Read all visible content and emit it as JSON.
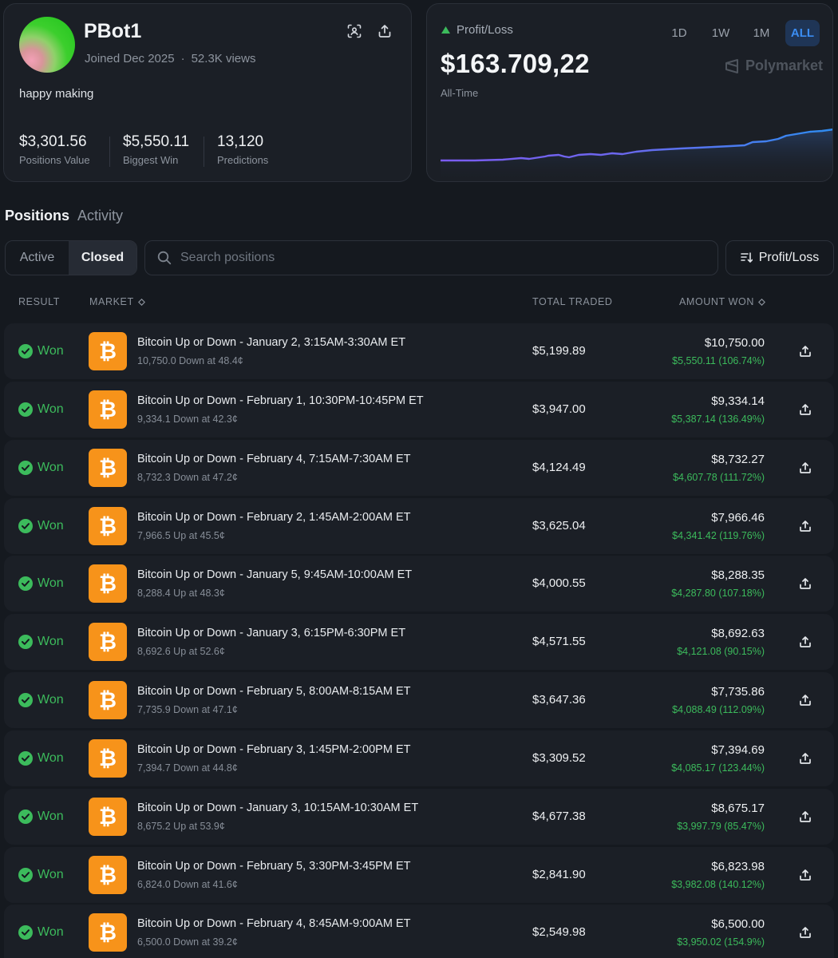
{
  "profile": {
    "username": "PBot1",
    "joined": "Joined Dec 2025",
    "views": "52.3K views",
    "bio": "happy making",
    "stats": [
      {
        "value": "$3,301.56",
        "label": "Positions Value"
      },
      {
        "value": "$5,550.11",
        "label": "Biggest Win"
      },
      {
        "value": "13,120",
        "label": "Predictions"
      }
    ],
    "icons": [
      "scan-icon",
      "share-icon"
    ]
  },
  "pnl": {
    "label": "Profit/Loss",
    "amount": "$163.709,22",
    "period": "All-Time",
    "ranges": [
      "1D",
      "1W",
      "1M",
      "ALL"
    ],
    "active_range": "ALL",
    "brand": "Polymarket",
    "colors": {
      "line_start": "#7b5cf0",
      "line_end": "#2e8cf0",
      "accent": "#3b8df2",
      "positive": "#3cbb5c"
    }
  },
  "tabs": {
    "positions": "Positions",
    "activity": "Activity"
  },
  "filters": {
    "active": "Active",
    "closed": "Closed",
    "selected": "Closed"
  },
  "search": {
    "placeholder": "Search positions"
  },
  "sort": {
    "label": "Profit/Loss"
  },
  "table": {
    "headers": {
      "result": "RESULT",
      "market": "MARKET",
      "total_traded": "TOTAL TRADED",
      "amount_won": "AMOUNT WON"
    },
    "rows": [
      {
        "result": "Won",
        "title": "Bitcoin Up or Down - January 2, 3:15AM-3:30AM ET",
        "sub": "10,750.0 Down at 48.4¢",
        "traded": "$5,199.89",
        "amount": "$10,750.00",
        "gain": "$5,550.11 (106.74%)"
      },
      {
        "result": "Won",
        "title": "Bitcoin Up or Down - February 1, 10:30PM-10:45PM ET",
        "sub": "9,334.1 Down at 42.3¢",
        "traded": "$3,947.00",
        "amount": "$9,334.14",
        "gain": "$5,387.14 (136.49%)"
      },
      {
        "result": "Won",
        "title": "Bitcoin Up or Down - February 4, 7:15AM-7:30AM ET",
        "sub": "8,732.3 Down at 47.2¢",
        "traded": "$4,124.49",
        "amount": "$8,732.27",
        "gain": "$4,607.78 (111.72%)"
      },
      {
        "result": "Won",
        "title": "Bitcoin Up or Down - February 2, 1:45AM-2:00AM ET",
        "sub": "7,966.5 Up at 45.5¢",
        "traded": "$3,625.04",
        "amount": "$7,966.46",
        "gain": "$4,341.42 (119.76%)"
      },
      {
        "result": "Won",
        "title": "Bitcoin Up or Down - January 5, 9:45AM-10:00AM ET",
        "sub": "8,288.4 Up at 48.3¢",
        "traded": "$4,000.55",
        "amount": "$8,288.35",
        "gain": "$4,287.80 (107.18%)"
      },
      {
        "result": "Won",
        "title": "Bitcoin Up or Down - January 3, 6:15PM-6:30PM ET",
        "sub": "8,692.6 Up at 52.6¢",
        "traded": "$4,571.55",
        "amount": "$8,692.63",
        "gain": "$4,121.08 (90.15%)"
      },
      {
        "result": "Won",
        "title": "Bitcoin Up or Down - February 5, 8:00AM-8:15AM ET",
        "sub": "7,735.9 Down at 47.1¢",
        "traded": "$3,647.36",
        "amount": "$7,735.86",
        "gain": "$4,088.49 (112.09%)"
      },
      {
        "result": "Won",
        "title": "Bitcoin Up or Down - February 3, 1:45PM-2:00PM ET",
        "sub": "7,394.7 Down at 44.8¢",
        "traded": "$3,309.52",
        "amount": "$7,394.69",
        "gain": "$4,085.17 (123.44%)"
      },
      {
        "result": "Won",
        "title": "Bitcoin Up or Down - January 3, 10:15AM-10:30AM ET",
        "sub": "8,675.2 Up at 53.9¢",
        "traded": "$4,677.38",
        "amount": "$8,675.17",
        "gain": "$3,997.79 (85.47%)"
      },
      {
        "result": "Won",
        "title": "Bitcoin Up or Down - February 5, 3:30PM-3:45PM ET",
        "sub": "6,824.0 Down at 41.6¢",
        "traded": "$2,841.90",
        "amount": "$6,823.98",
        "gain": "$3,982.08 (140.12%)"
      },
      {
        "result": "Won",
        "title": "Bitcoin Up or Down - February 4, 8:45AM-9:00AM ET",
        "sub": "6,500.0 Down at 39.2¢",
        "traded": "$2,549.98",
        "amount": "$6,500.00",
        "gain": "$3,950.02 (154.9%)"
      }
    ]
  }
}
